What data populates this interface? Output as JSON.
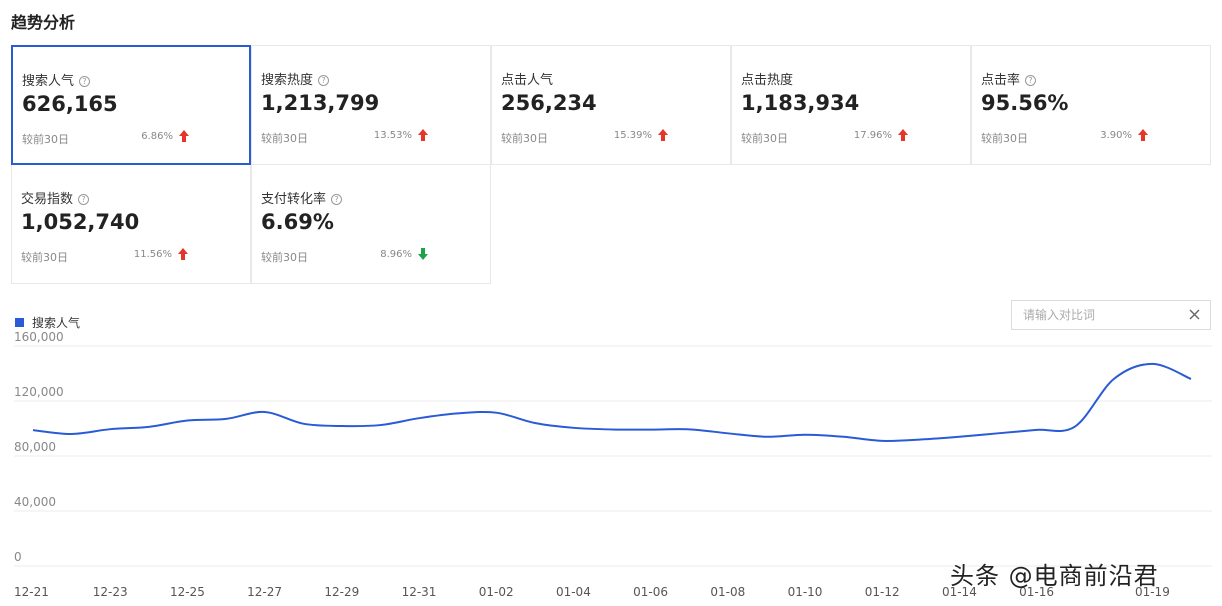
{
  "section_title": "趋势分析",
  "cards": [
    {
      "label": "搜索人气",
      "value": "626,165",
      "compare": "较前30日",
      "change": "6.86%",
      "direction": "up",
      "active": true
    },
    {
      "label": "搜索热度",
      "value": "1,213,799",
      "compare": "较前30日",
      "change": "13.53%",
      "direction": "up",
      "active": false
    },
    {
      "label": "点击人气",
      "value": "256,234",
      "compare": "较前30日",
      "change": "15.39%",
      "direction": "up",
      "active": false
    },
    {
      "label": "点击热度",
      "value": "1,183,934",
      "compare": "较前30日",
      "change": "17.96%",
      "direction": "up",
      "active": false
    },
    {
      "label": "点击率",
      "value": "95.56%",
      "compare": "较前30日",
      "change": "3.90%",
      "direction": "up",
      "active": false
    },
    {
      "label": "交易指数",
      "value": "1,052,740",
      "compare": "较前30日",
      "change": "11.56%",
      "direction": "up",
      "active": false
    },
    {
      "label": "支付转化率",
      "value": "6.69%",
      "compare": "较前30日",
      "change": "8.96%",
      "direction": "down",
      "active": false
    }
  ],
  "help_icons": [
    true,
    true,
    false,
    false,
    true,
    true,
    true
  ],
  "colors": {
    "accent": "#2a5bd7",
    "up": "#e5342a",
    "down": "#1aa34a"
  },
  "compare_search": {
    "placeholder": "请输入对比词",
    "value": ""
  },
  "chart_data": {
    "type": "line",
    "series": [
      {
        "name": "搜索人气",
        "color": "#2a5bd7",
        "values": [
          98800,
          96000,
          99500,
          101200,
          105800,
          107000,
          112000,
          103500,
          101800,
          102500,
          107500,
          111000,
          111500,
          104000,
          100500,
          99300,
          99200,
          99400,
          96500,
          94000,
          95500,
          94000,
          91000,
          92000,
          94000,
          96500,
          99000,
          101500,
          136000,
          147000,
          136000
        ]
      }
    ],
    "x": [
      "12-21",
      "12-22",
      "12-23",
      "12-24",
      "12-25",
      "12-26",
      "12-27",
      "12-28",
      "12-29",
      "12-30",
      "12-31",
      "01-01",
      "01-02",
      "01-03",
      "01-04",
      "01-05",
      "01-06",
      "01-07",
      "01-08",
      "01-09",
      "01-10",
      "01-11",
      "01-12",
      "01-13",
      "01-14",
      "01-15",
      "01-16",
      "01-17",
      "01-18",
      "01-19"
    ],
    "x_ticks": [
      "12-21",
      "12-23",
      "12-25",
      "12-27",
      "12-29",
      "12-31",
      "01-02",
      "01-04",
      "01-06",
      "01-08",
      "01-10",
      "01-12",
      "01-14",
      "01-16",
      "01-19"
    ],
    "y_ticks": [
      "0",
      "40,000",
      "80,000",
      "120,000",
      "160,000"
    ],
    "ylim": [
      0,
      160000
    ],
    "grid": true,
    "legend": "top-left"
  },
  "watermark": "头条 @电商前沿君"
}
